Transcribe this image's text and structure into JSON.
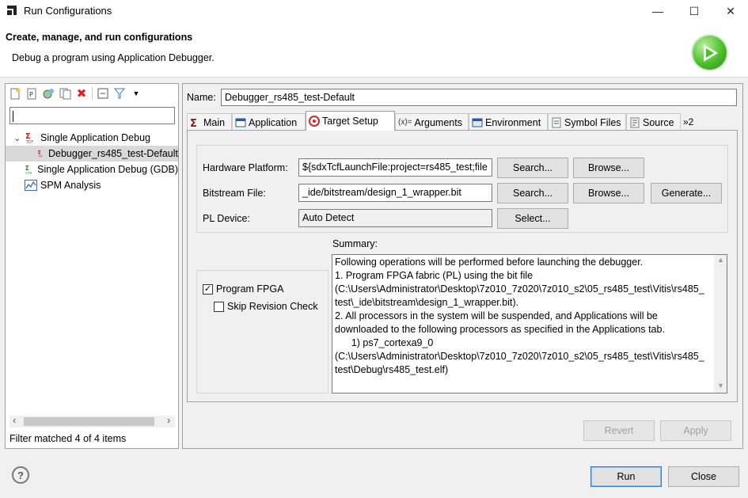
{
  "window": {
    "title": "Run Configurations",
    "minimize_glyph": "—",
    "maximize_glyph": "☐",
    "close_glyph": "✕"
  },
  "header": {
    "title": "Create, manage, and run configurations",
    "subtitle": "Debug a program using Application Debugger."
  },
  "left": {
    "filter_value": "",
    "tree": [
      {
        "label": "Single Application Debug",
        "icon": "tcf-icon",
        "expand": "⌄"
      },
      {
        "label": "Debugger_rs485_test-Default",
        "icon": "tcf-icon"
      },
      {
        "label": "Single Application Debug (GDB)",
        "icon": "gdb-icon"
      },
      {
        "label": "SPM Analysis",
        "icon": "chart-icon"
      }
    ],
    "status": "Filter matched 4 of 4 items",
    "scroll_left": "‹",
    "scroll_right": "›"
  },
  "right": {
    "name_label": "Name:",
    "name_value": "Debugger_rs485_test-Default",
    "tabs": [
      {
        "label": "Main"
      },
      {
        "label": "Application"
      },
      {
        "label": "Target Setup"
      },
      {
        "label": "Arguments"
      },
      {
        "label": "Environment"
      },
      {
        "label": "Symbol Files"
      },
      {
        "label": "Source"
      },
      {
        "label": "»2"
      }
    ],
    "hw_label": "Hardware Platform:",
    "hw_value": "${sdxTcfLaunchFile:project=rs485_test;file",
    "bit_label": "Bitstream File:",
    "bit_value": "_ide/bitstream/design_1_wrapper.bit",
    "pl_label": "PL Device:",
    "pl_value": "Auto Detect",
    "search_label": "Search...",
    "browse_label": "Browse...",
    "generate_label": "Generate...",
    "select_label": "Select...",
    "program_fpga": "Program FPGA",
    "skip_revision": "Skip Revision Check",
    "summary_label": "Summary:",
    "summary_text": "Following operations will be performed before launching the debugger.\n1. Program FPGA fabric (PL) using the bit file\n(C:\\Users\\Administrator\\Desktop\\7z010_7z020\\7z010_s2\\05_rs485_test\\Vitis\\rs485_\ntest\\_ide\\bitstream\\design_1_wrapper.bit).\n2. All processors in the system will be suspended, and Applications will be\ndownloaded to the following processors as specified in the Applications tab.\n      1) ps7_cortexa9_0\n(C:\\Users\\Administrator\\Desktop\\7z010_7z020\\7z010_s2\\05_rs485_test\\Vitis\\rs485_\ntest\\Debug\\rs485_test.elf)",
    "revert_label": "Revert",
    "apply_label": "Apply"
  },
  "footer": {
    "help_glyph": "?",
    "run_label": "Run",
    "close_label": "Close"
  }
}
